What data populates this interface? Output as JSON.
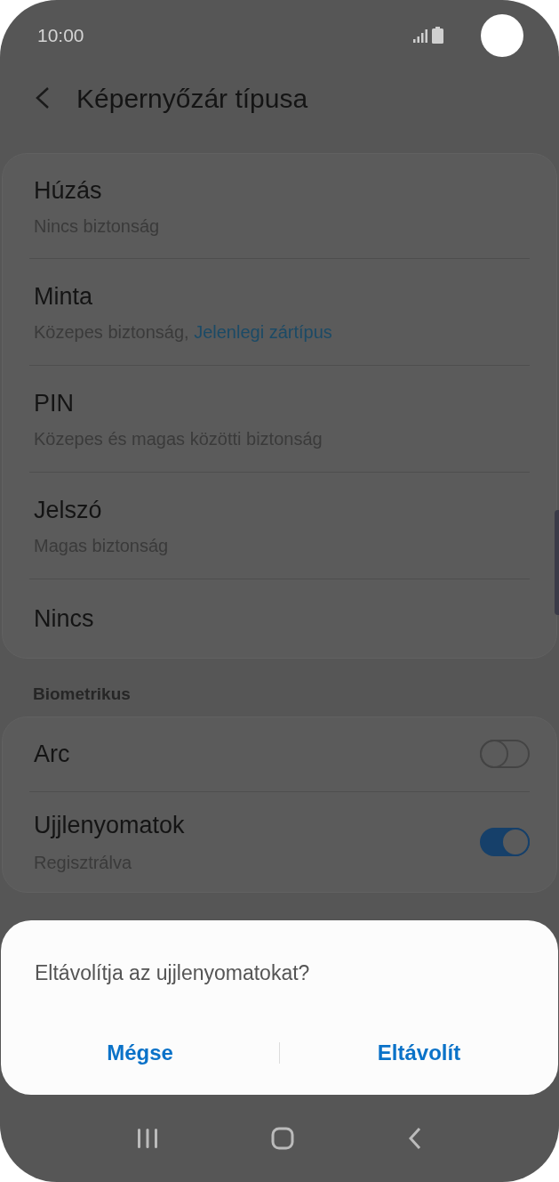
{
  "status_bar": {
    "time": "10:00"
  },
  "header": {
    "title": "Képernyőzár típusa"
  },
  "lock_types": [
    {
      "title": "Húzás",
      "subtitle": "Nincs biztonság"
    },
    {
      "title": "Minta",
      "subtitle": "Közepes biztonság,",
      "current_label": "Jelenlegi zártípus"
    },
    {
      "title": "PIN",
      "subtitle": "Közepes és magas közötti biztonság"
    },
    {
      "title": "Jelszó",
      "subtitle": "Magas biztonság"
    },
    {
      "title": "Nincs"
    }
  ],
  "biometric": {
    "header": "Biometrikus",
    "items": [
      {
        "title": "Arc",
        "on": false
      },
      {
        "title": "Ujjlenyomatok",
        "subtitle": "Regisztrálva",
        "on": true
      }
    ]
  },
  "dialog": {
    "message": "Eltávolítja az ujjlenyomatokat?",
    "buttons": [
      "Mégse",
      "Eltávolít"
    ]
  }
}
